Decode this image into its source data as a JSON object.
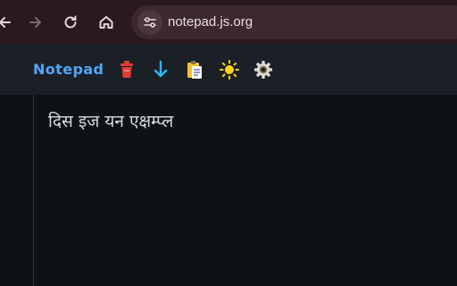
{
  "browser": {
    "url": "notepad.js.org",
    "icons": {
      "back": "arrow-left-icon",
      "forward": "arrow-right-icon",
      "reload": "reload-icon",
      "home": "home-icon",
      "site_info": "site-settings-icon"
    }
  },
  "app": {
    "title": "Notepad",
    "title_color": "#4ea8f5",
    "toolbar": [
      {
        "name": "delete-note",
        "icon": "trash-icon",
        "color": "#e53935"
      },
      {
        "name": "download-note",
        "icon": "arrow-down-icon",
        "color": "#29b6f6"
      },
      {
        "name": "copy-to-clipboard",
        "icon": "clipboard-icon",
        "color": "#f4c430"
      },
      {
        "name": "toggle-theme",
        "icon": "sun-icon",
        "color": "#ffd21a"
      },
      {
        "name": "settings",
        "icon": "gear-icon",
        "color": "#d9d9d9"
      }
    ]
  },
  "editor": {
    "text": "दिस इज यन एक्षम्प्ल"
  },
  "colors": {
    "browser_chrome": "#2a1a20",
    "toolbar_bg": "#1b2027",
    "editor_bg": "#0e1217"
  }
}
